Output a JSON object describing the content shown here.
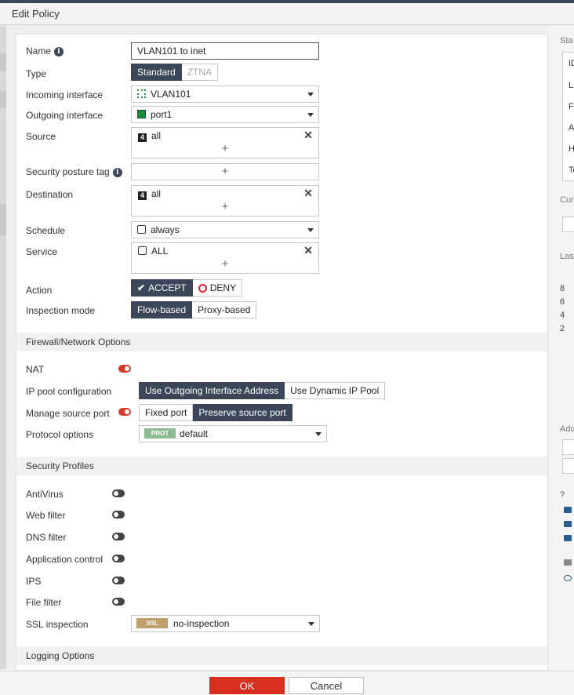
{
  "title": "Edit Policy",
  "form": {
    "name_label": "Name",
    "name_value": "VLAN101 to inet",
    "type_label": "Type",
    "type_options": [
      "Standard",
      "ZTNA"
    ],
    "incoming_label": "Incoming interface",
    "incoming_value": "VLAN101",
    "outgoing_label": "Outgoing interface",
    "outgoing_value": "port1",
    "source_label": "Source",
    "source_value": "all",
    "posture_label": "Security posture tag",
    "destination_label": "Destination",
    "destination_value": "all",
    "schedule_label": "Schedule",
    "schedule_value": "always",
    "service_label": "Service",
    "service_value": "ALL",
    "action_label": "Action",
    "action_accept": "ACCEPT",
    "action_deny": "DENY",
    "inspection_label": "Inspection mode",
    "inspection_options": [
      "Flow-based",
      "Proxy-based"
    ],
    "plus": "+",
    "remove": "✕",
    "info": "i",
    "addr_icon": "4"
  },
  "firewall": {
    "header": "Firewall/Network Options",
    "nat_label": "NAT",
    "ippool_label": "IP pool configuration",
    "ippool_options": [
      "Use Outgoing Interface Address",
      "Use Dynamic IP Pool"
    ],
    "manage_port_label": "Manage source port",
    "port_options": [
      "Fixed port",
      "Preserve source port"
    ],
    "protocol_label": "Protocol options",
    "protocol_badge": "PROT",
    "protocol_value": "default",
    "toggle_color": "#d23c2a"
  },
  "security": {
    "header": "Security Profiles",
    "profiles": [
      "AntiVirus",
      "Web filter",
      "DNS filter",
      "Application control",
      "IPS",
      "File filter"
    ],
    "ssl_label": "SSL inspection",
    "ssl_badge": "SSL",
    "ssl_value": "no-inspection"
  },
  "logging": {
    "header": "Logging Options"
  },
  "buttons": {
    "ok": "OK",
    "cancel": "Cancel"
  },
  "right_panel": {
    "stat_header": "Sta",
    "rows": [
      "ID",
      "L",
      "F",
      "A",
      "H",
      "To"
    ],
    "cur": "Cur",
    "last": "Las",
    "nums": [
      "8",
      "6",
      "4",
      "2"
    ],
    "add": "Add",
    "help": "?"
  },
  "colors": {
    "accent": "#3b4659",
    "ok_button": "#d83020",
    "green_icon": "#1b8a3c",
    "prot_badge": "#8fbc8f",
    "ssl_badge": "#bfa06a"
  }
}
